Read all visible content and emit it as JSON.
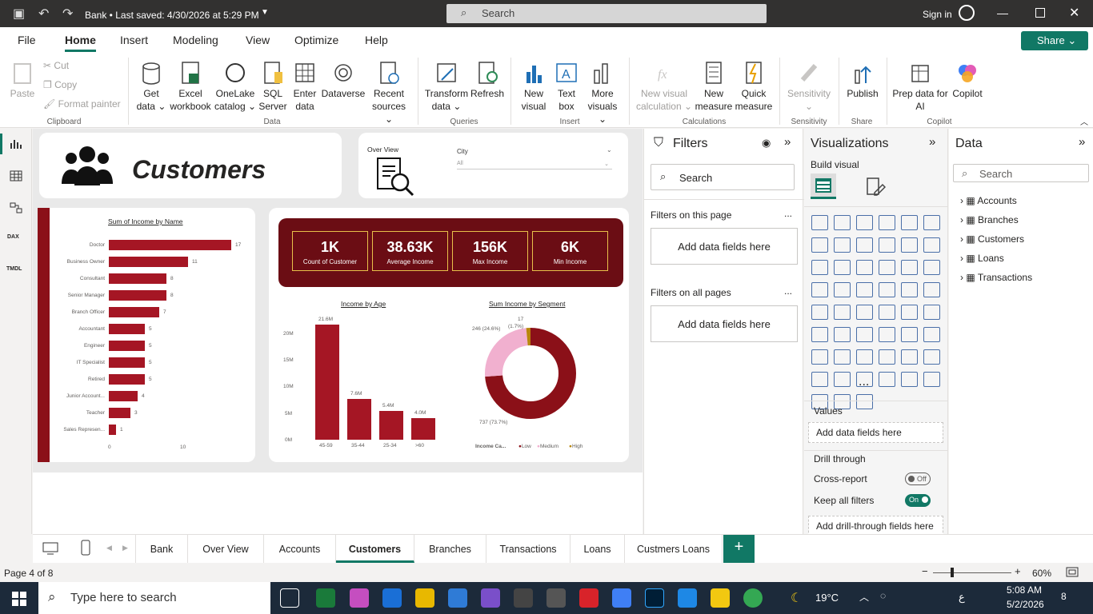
{
  "titlebar": {
    "doc_title": "Bank • Last saved: 4/30/2026 at 5:29 PM",
    "search_placeholder": "Search",
    "sign_in": "Sign in"
  },
  "menu_tabs": [
    "File",
    "Home",
    "Insert",
    "Modeling",
    "View",
    "Optimize",
    "Help"
  ],
  "share_label": "Share",
  "ribbon": {
    "clipboard": {
      "paste": "Paste",
      "cut": "Cut",
      "copy": "Copy",
      "format_painter": "Format painter",
      "group": "Clipboard"
    },
    "data": {
      "get_data": "Get data",
      "excel": "Excel workbook",
      "onelake": "OneLake catalog",
      "sql": "SQL Server",
      "enter": "Enter data",
      "dataverse": "Dataverse",
      "recent": "Recent sources",
      "group": "Data"
    },
    "queries": {
      "transform": "Transform data",
      "refresh": "Refresh",
      "group": "Queries"
    },
    "insert": {
      "new_visual": "New visual",
      "text_box": "Text box",
      "more_visuals": "More visuals",
      "group": "Insert"
    },
    "calculations": {
      "new_visual_calc": "New visual calculation",
      "new_measure": "New measure",
      "quick_measure": "Quick measure",
      "group": "Calculations"
    },
    "sensitivity": {
      "label": "Sensitivity",
      "group": "Sensitivity"
    },
    "share": {
      "publish": "Publish",
      "group": "Share"
    },
    "copilot": {
      "prep": "Prep data for AI",
      "copilot": "Copilot",
      "group": "Copilot"
    }
  },
  "report": {
    "title": "Customers",
    "overview_label": "Over View",
    "slicer": {
      "label": "City",
      "value": "All"
    },
    "income_by_name": {
      "title": "Sum of Income by Name",
      "axis_ticks": [
        "0",
        "10"
      ]
    },
    "kpis": [
      {
        "value": "1K",
        "label": "Count of Customer"
      },
      {
        "value": "38.63K",
        "label": "Average Income"
      },
      {
        "value": "156K",
        "label": "Max Income"
      },
      {
        "value": "6K",
        "label": "Min Income"
      }
    ],
    "income_by_age": {
      "title": "Income by Age",
      "y_ticks": [
        "20M",
        "15M",
        "10M",
        "5M",
        "0M"
      ]
    },
    "income_by_segment": {
      "title": "Sum Income by Segment",
      "legend_title": "Income Ca...",
      "labels": {
        "medium": "246 (24.6%)",
        "high_val": "17",
        "high_pct": "(1.7%)",
        "low": "737 (73.7%)"
      }
    }
  },
  "chart_data": [
    {
      "type": "bar",
      "orientation": "horizontal",
      "title": "Sum of Income by Name",
      "categories": [
        "Doctor",
        "Business Owner",
        "Consultant",
        "Senior Manager",
        "Branch Officer",
        "Accountant",
        "Engineer",
        "IT Specialist",
        "Retired",
        "Junior Account...",
        "Teacher",
        "Sales Represen..."
      ],
      "values": [
        17,
        11,
        8,
        8,
        7,
        5,
        5,
        5,
        5,
        4,
        3,
        1
      ],
      "xlim": [
        0,
        17
      ]
    },
    {
      "type": "bar",
      "title": "Income by Age",
      "categories": [
        "45-59",
        "35-44",
        "25-34",
        ">60"
      ],
      "values": [
        21.6,
        7.6,
        5.4,
        4.0
      ],
      "value_labels": [
        "21.6M",
        "7.6M",
        "5.4M",
        "4.0M"
      ],
      "ylabel_unit": "M",
      "ylim": [
        0,
        20
      ]
    },
    {
      "type": "pie",
      "variant": "donut",
      "title": "Sum Income by Segment",
      "series": [
        {
          "name": "Low",
          "value": 737,
          "pct": 73.7,
          "color": "#8b1018"
        },
        {
          "name": "Medium",
          "value": 246,
          "pct": 24.6,
          "color": "#f1b0cf"
        },
        {
          "name": "High",
          "value": 17,
          "pct": 1.7,
          "color": "#b8860b"
        }
      ]
    }
  ],
  "filters": {
    "title": "Filters",
    "search": "Search",
    "on_page": "Filters on this page",
    "on_all": "Filters on all pages",
    "add": "Add data fields here",
    "more": "..."
  },
  "visualizations": {
    "title": "Visualizations",
    "build": "Build visual",
    "values": "Values",
    "add_values": "Add data fields here",
    "drill": "Drill through",
    "cross": "Cross-report",
    "cross_state": "Off",
    "keep": "Keep all filters",
    "keep_state": "On",
    "add_drill": "Add drill-through fields here",
    "more": "..."
  },
  "data_pane": {
    "title": "Data",
    "search": "Search",
    "tables": [
      "Accounts",
      "Branches",
      "Customers",
      "Loans",
      "Transactions"
    ]
  },
  "page_tabs": [
    "Bank",
    "Over View",
    "Accounts",
    "Customers",
    "Branches",
    "Transactions",
    "Loans",
    "Custmers Loans"
  ],
  "active_page": "Customers",
  "status": {
    "page": "Page 4 of 8",
    "zoom": "60%",
    "zoom_level": 0.6
  },
  "taskbar": {
    "search": "Type here to search",
    "temp": "19°C",
    "time": "5:08 AM",
    "date": "5/2/2026",
    "lang": "ع",
    "notif": "8"
  },
  "colors": {
    "accent": "#117865",
    "bar": "#a51624",
    "kpi_bg": "#6b0d14",
    "kpi_border": "#e8c04a"
  }
}
